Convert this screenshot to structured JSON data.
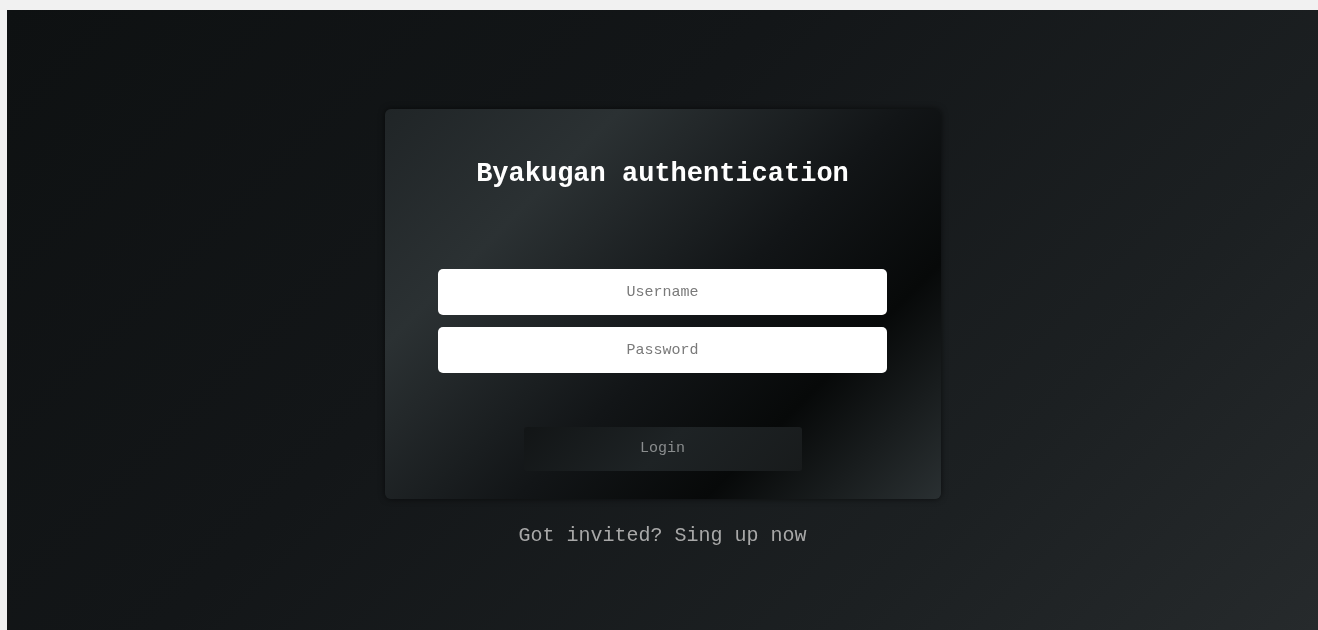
{
  "title": "Byakugan authentication",
  "fields": [
    {
      "placeholder": "Username"
    },
    {
      "placeholder": "Password"
    }
  ],
  "login_button": "Login",
  "signup_link": "Got invited? Sing up now"
}
